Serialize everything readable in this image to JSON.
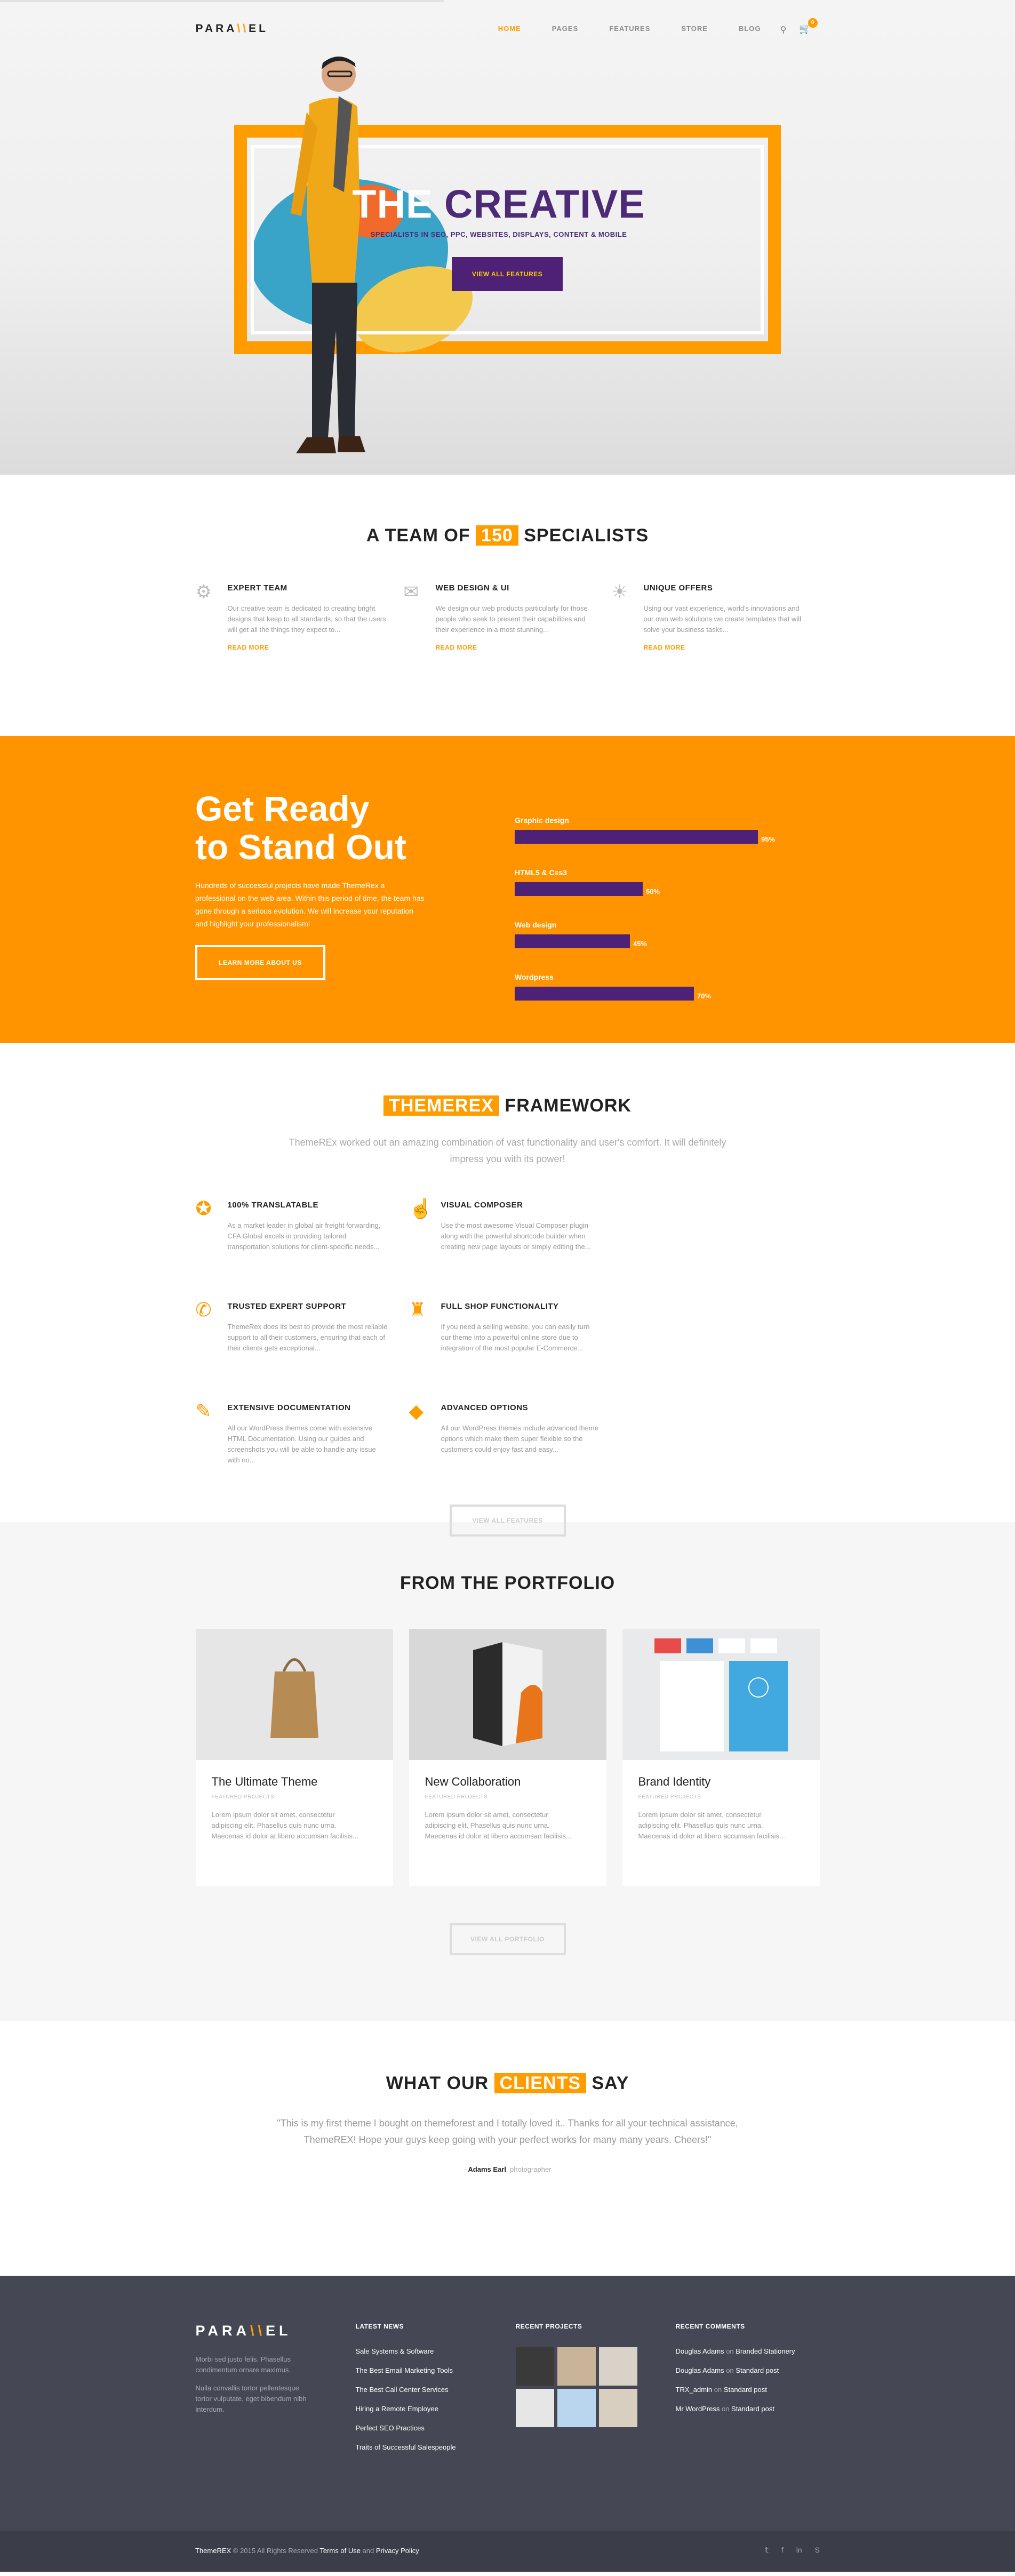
{
  "header": {
    "logo": "PARA",
    "logo_mark": "\\\\",
    "logo_tail": "EL",
    "nav": [
      "HOME",
      "PAGES",
      "FEATURES",
      "STORE",
      "BLOG"
    ],
    "cart_count": "0"
  },
  "hero": {
    "title_a": "THE ",
    "title_b": "CREATIVE",
    "subtitle": "SPECIALISTS IN SEO, PPC, WEBSITES, DISPLAYS, CONTENT & MOBILE",
    "button": "VIEW ALL FEATURES"
  },
  "team": {
    "title_pre": "A TEAM OF",
    "title_num": "150",
    "title_post": "SPECIALISTS",
    "cols": [
      {
        "title": "EXPERT TEAM",
        "text": "Our creative team is dedicated to creating bright designs that keep to all standards, so that the users will get all the things they expect to...",
        "more": "READ MORE"
      },
      {
        "title": "WEB DESIGN & UI",
        "text": "We design our web products particularly for those people who seek to present their capabilities and their experience in a most stunning...",
        "more": "READ MORE"
      },
      {
        "title": "UNIQUE OFFERS",
        "text": "Using our vast experience, world's innovations and our own web solutions we create templates that will solve your business tasks...",
        "more": "READ MORE"
      }
    ]
  },
  "ready": {
    "title_1": "Get Ready",
    "title_2": "to Stand Out",
    "text": "Hundreds of successful projects have made ThemeRex a professional on the web area. Within this period of time, the team has gone through a serious evolution. We will increase your reputation and highlight your professionalism!",
    "button": "LEARN MORE ABOUT US",
    "skills": [
      {
        "label": "Graphic design",
        "value": 95,
        "pct": "95%"
      },
      {
        "label": "HTML5 & Css3",
        "value": 50,
        "pct": "50%"
      },
      {
        "label": "Web design",
        "value": 45,
        "pct": "45%"
      },
      {
        "label": "Wordpress",
        "value": 70,
        "pct": "70%"
      }
    ]
  },
  "framework": {
    "title_hl": "THEMEREX",
    "title_post": "FRAMEWORK",
    "subtitle": "ThemeREx worked out an amazing combination of vast functionality and user's comfort. It will definitely impress you with its power!",
    "items": [
      {
        "icon": "life-ring-icon",
        "glyph": "✪",
        "title": "100% TRANSLATABLE",
        "text": "As a market leader in global air freight forwarding, CFA Global excels in providing tailored transportation solutions for client-specific needs..."
      },
      {
        "icon": "thumbs-up-icon",
        "glyph": "☝",
        "title": "VISUAL COMPOSER",
        "text": "Use the most awesome Visual Composer plugin along with the powerful shortcode builder when creating new page layouts or simply editing the..."
      },
      {
        "icon": "chat-icon",
        "glyph": "✆",
        "title": "TRUSTED EXPERT SUPPORT",
        "text": "ThemeRex does its best to provide the most reliable support to all their customers, ensuring that each of their clients gets exceptional..."
      },
      {
        "icon": "shopping-bag-icon",
        "glyph": "♜",
        "title": "FULL SHOP FUNCTIONALITY",
        "text": "If you need a selling website, you can easily turn our theme into a powerful online store due to integration of the most popular E-Commerce..."
      },
      {
        "icon": "document-icon",
        "glyph": "✎",
        "title": "EXTENSIVE DOCUMENTATION",
        "text": "All our WordPress themes come with extensive HTML Documentation. Using our guides and screenshots you will be able to handle any issue with no..."
      },
      {
        "icon": "diamond-icon",
        "glyph": "◆",
        "title": "ADVANCED OPTIONS",
        "text": "All our WordPress themes include advanced theme options which make them super flexible so the customers could enjoy fast and easy..."
      }
    ],
    "button": "VIEW ALL FEATURES"
  },
  "portfolio": {
    "title": "FROM THE PORTFOLIO",
    "items": [
      {
        "title": "The Ultimate Theme",
        "cat": "FEATURED PROJECTS",
        "text": "Lorem ipsum dolor sit amet, consectetur adipiscing elit. Phasellus quis nunc urna. Maecenas id dolor at libero accumsan facilisis..."
      },
      {
        "title": "New Collaboration",
        "cat": "FEATURED PROJECTS",
        "text": "Lorem ipsum dolor sit amet, consectetur adipiscing elit. Phasellus quis nunc urna. Maecenas id dolor at libero accumsan facilisis..."
      },
      {
        "title": "Brand Identity",
        "cat": "FEATURED PROJECTS",
        "text": "Lorem ipsum dolor sit amet, consectetur adipiscing elit. Phasellus quis nunc urna. Maecenas id dolor at libero accumsan facilisis..."
      }
    ],
    "button": "VIEW ALL PORTFOLIO"
  },
  "clients": {
    "title_pre": "WHAT OUR",
    "title_hl": "CLIENTS",
    "title_post": "SAY",
    "quote": "\"This is my first theme I bought on themeforest and I totally loved it.. Thanks for all your technical assistance, ThemeREX! Hope your guys keep going with your perfect works for many many years. Cheers!\"",
    "author": "Adams Earl",
    "role": ", photographer"
  },
  "footer": {
    "desc_1": "Morbi sed justo felis. Phasellus condimentum ornare maximus.",
    "desc_2": "Nulla convallis tortor pellentesque tortor vulputate, eget bibendum nibh interdum.",
    "news_title": "LATEST NEWS",
    "news": [
      "Sale Systems & Software",
      "The Best Email Marketing Tools",
      "The Best Call Center Services",
      "Hiring a Remote Employee",
      "Perfect SEO Practices",
      "Traits of Successful Salespeople"
    ],
    "projects_title": "RECENT PROJECTS",
    "comments_title": "RECENT COMMENTS",
    "comments": [
      {
        "who": "Douglas Adams",
        "on": "on",
        "post": "Branded Stationery"
      },
      {
        "who": "Douglas Adams",
        "on": "on",
        "post": "Standard post"
      },
      {
        "who": "TRX_admin",
        "on": "on",
        "post": "Standard post"
      },
      {
        "who": "Mr WordPress",
        "on": "on",
        "post": "Standard post"
      }
    ]
  },
  "bottom": {
    "copy_a": "ThemeREX",
    "copy_b": " © 2015 All Rights Reserved ",
    "terms": "Terms of Use",
    "and": " and ",
    "privacy": "Privacy Policy"
  },
  "colors": {
    "accent": "#ff9c00",
    "purple": "#4c2176",
    "footer": "#454854"
  }
}
